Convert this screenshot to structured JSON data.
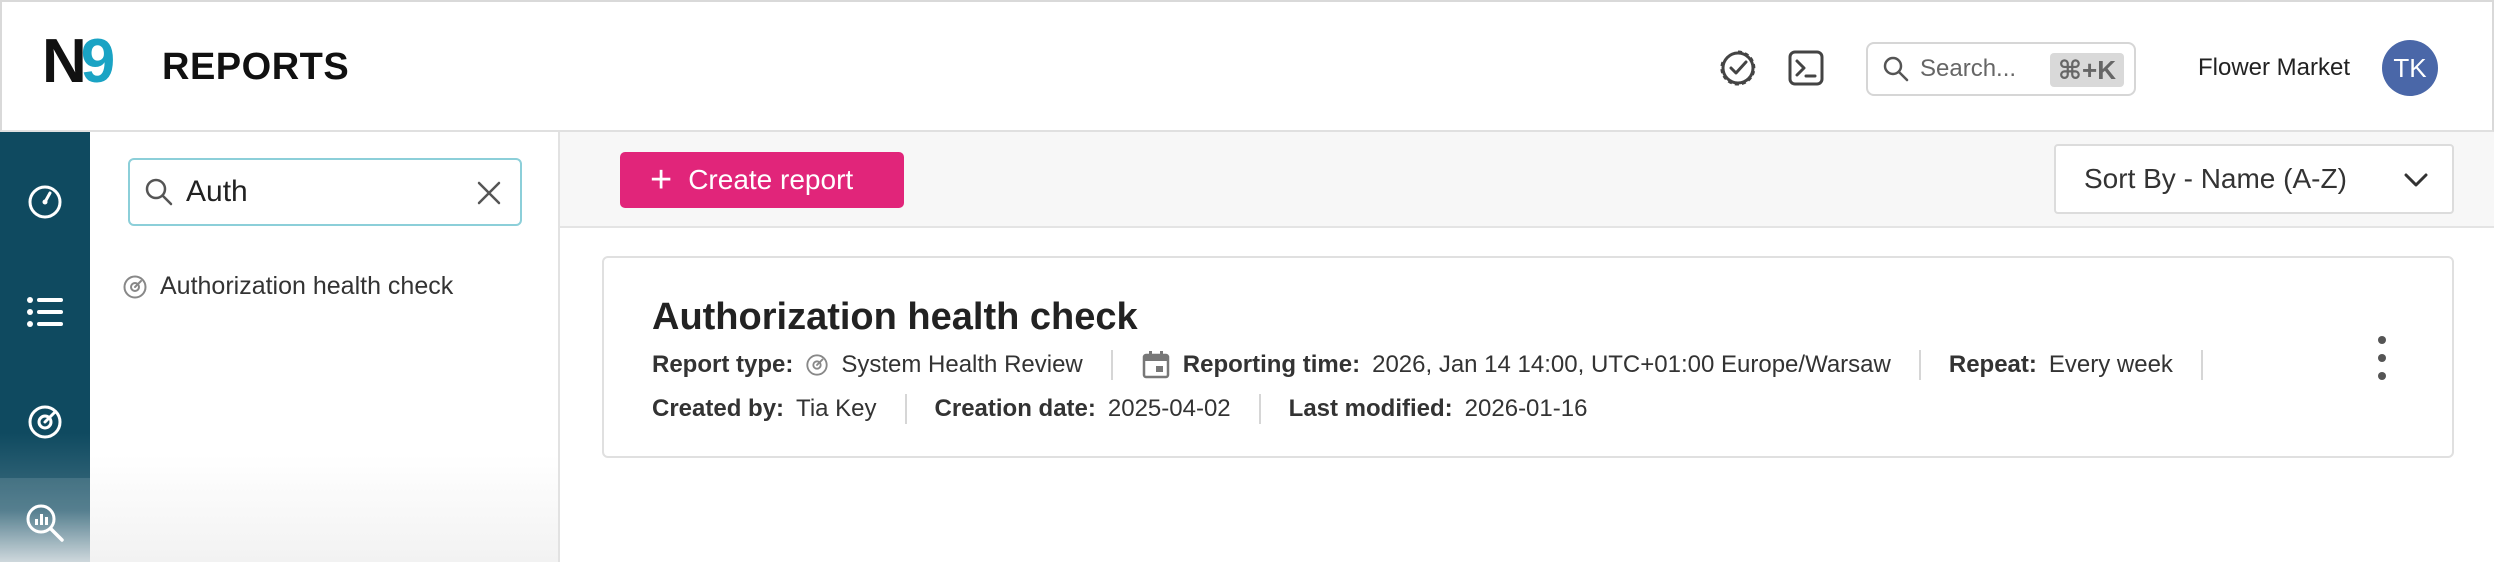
{
  "header": {
    "logo_letter": "N",
    "logo_digit": "9",
    "title": "REPORTS",
    "search_placeholder": "Search...",
    "search_shortcut": "⌘+K",
    "org_name": "Flower Market",
    "avatar_initials": "TK"
  },
  "rail": {
    "items": [
      "dashboard-icon",
      "list-icon",
      "health-check-icon",
      "reports-search-icon"
    ],
    "active": "reports-search-icon"
  },
  "side_panel": {
    "filter_value": "Auth",
    "results": [
      {
        "label": "Authorization health check",
        "icon": "health-check-icon"
      }
    ]
  },
  "toolbar": {
    "create_label": "Create report",
    "sort_label": "Sort By - Name (A-Z)"
  },
  "report_card": {
    "title": "Authorization health check",
    "report_type_key": "Report type:",
    "report_type_value": "System Health Review",
    "reporting_time_key": "Reporting time:",
    "reporting_time_value": "2026, Jan 14 14:00, UTC+01:00 Europe/Warsaw",
    "repeat_key": "Repeat:",
    "repeat_value": "Every week",
    "created_by_key": "Created by:",
    "created_by_value": "Tia Key",
    "creation_date_key": "Creation date:",
    "creation_date_value": "2025-04-02",
    "last_modified_key": "Last modified:",
    "last_modified_value": "2026-01-16"
  },
  "colors": {
    "brand_teal": "#1aa3c4",
    "rail_bg": "#0f4a60",
    "create_button": "#e1257a",
    "avatar_bg": "#4a67a8",
    "filter_border": "#8ccfd9"
  }
}
